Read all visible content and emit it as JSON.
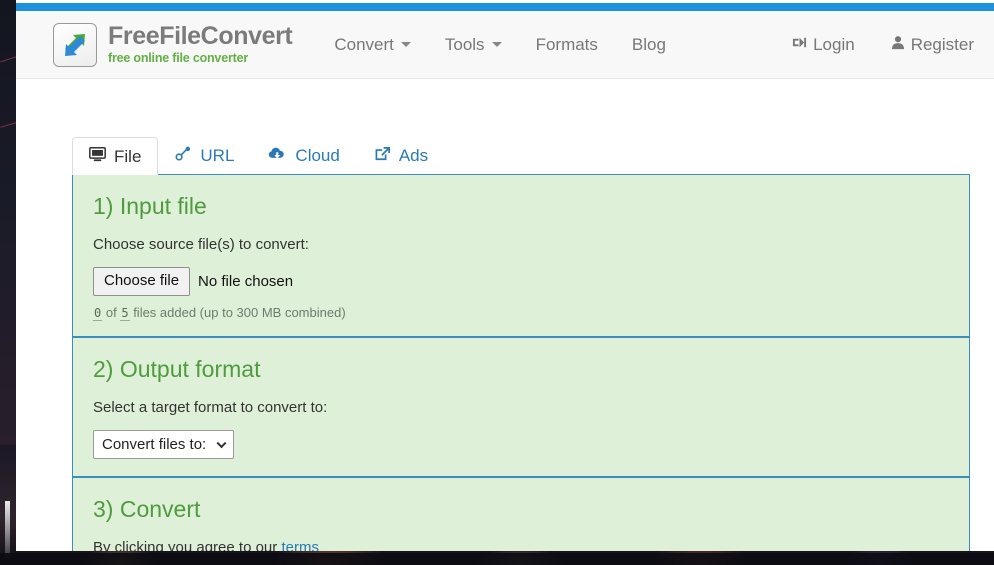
{
  "brand": {
    "name": "FreeFileConvert",
    "tagline": "free online file converter",
    "logo_icon": "two-arrows-convert-icon"
  },
  "nav": {
    "items": [
      {
        "label": "Convert",
        "has_caret": true
      },
      {
        "label": "Tools",
        "has_caret": true
      },
      {
        "label": "Formats",
        "has_caret": false
      },
      {
        "label": "Blog",
        "has_caret": false
      }
    ],
    "right": [
      {
        "label": "Login",
        "icon": "sign-in-icon"
      },
      {
        "label": "Register",
        "icon": "user-icon"
      }
    ]
  },
  "tabs": [
    {
      "label": "File",
      "icon": "desktop-monitor-icon",
      "active": true
    },
    {
      "label": "URL",
      "icon": "link-chain-icon",
      "active": false
    },
    {
      "label": "Cloud",
      "icon": "cloud-download-icon",
      "active": false
    },
    {
      "label": "Ads",
      "icon": "external-link-icon",
      "active": false
    }
  ],
  "sections": {
    "input": {
      "title": "1) Input file",
      "label": "Choose source file(s) to convert:",
      "button_label": "Choose file",
      "file_status": "No file chosen",
      "count_current": "0",
      "count_of": "of",
      "count_max": "5",
      "count_suffix": "files added (up to 300 MB combined)"
    },
    "output": {
      "title": "2) Output format",
      "label": "Select a target format to convert to:",
      "select_value": "Convert files to:",
      "select_options": [
        "Convert files to:"
      ]
    },
    "convert": {
      "title": "3) Convert",
      "terms_prefix": "By clicking you agree to our ",
      "terms_link": "terms"
    }
  },
  "colors": {
    "accent_blue": "#1e90e0",
    "panel_border": "#3c8dbc",
    "panel_bg": "#dff0d8",
    "section_title_green": "#4f9b3f",
    "link_blue": "#2a7ab8",
    "brand_gray": "#7b7b7b",
    "brand_green": "#62b045"
  }
}
